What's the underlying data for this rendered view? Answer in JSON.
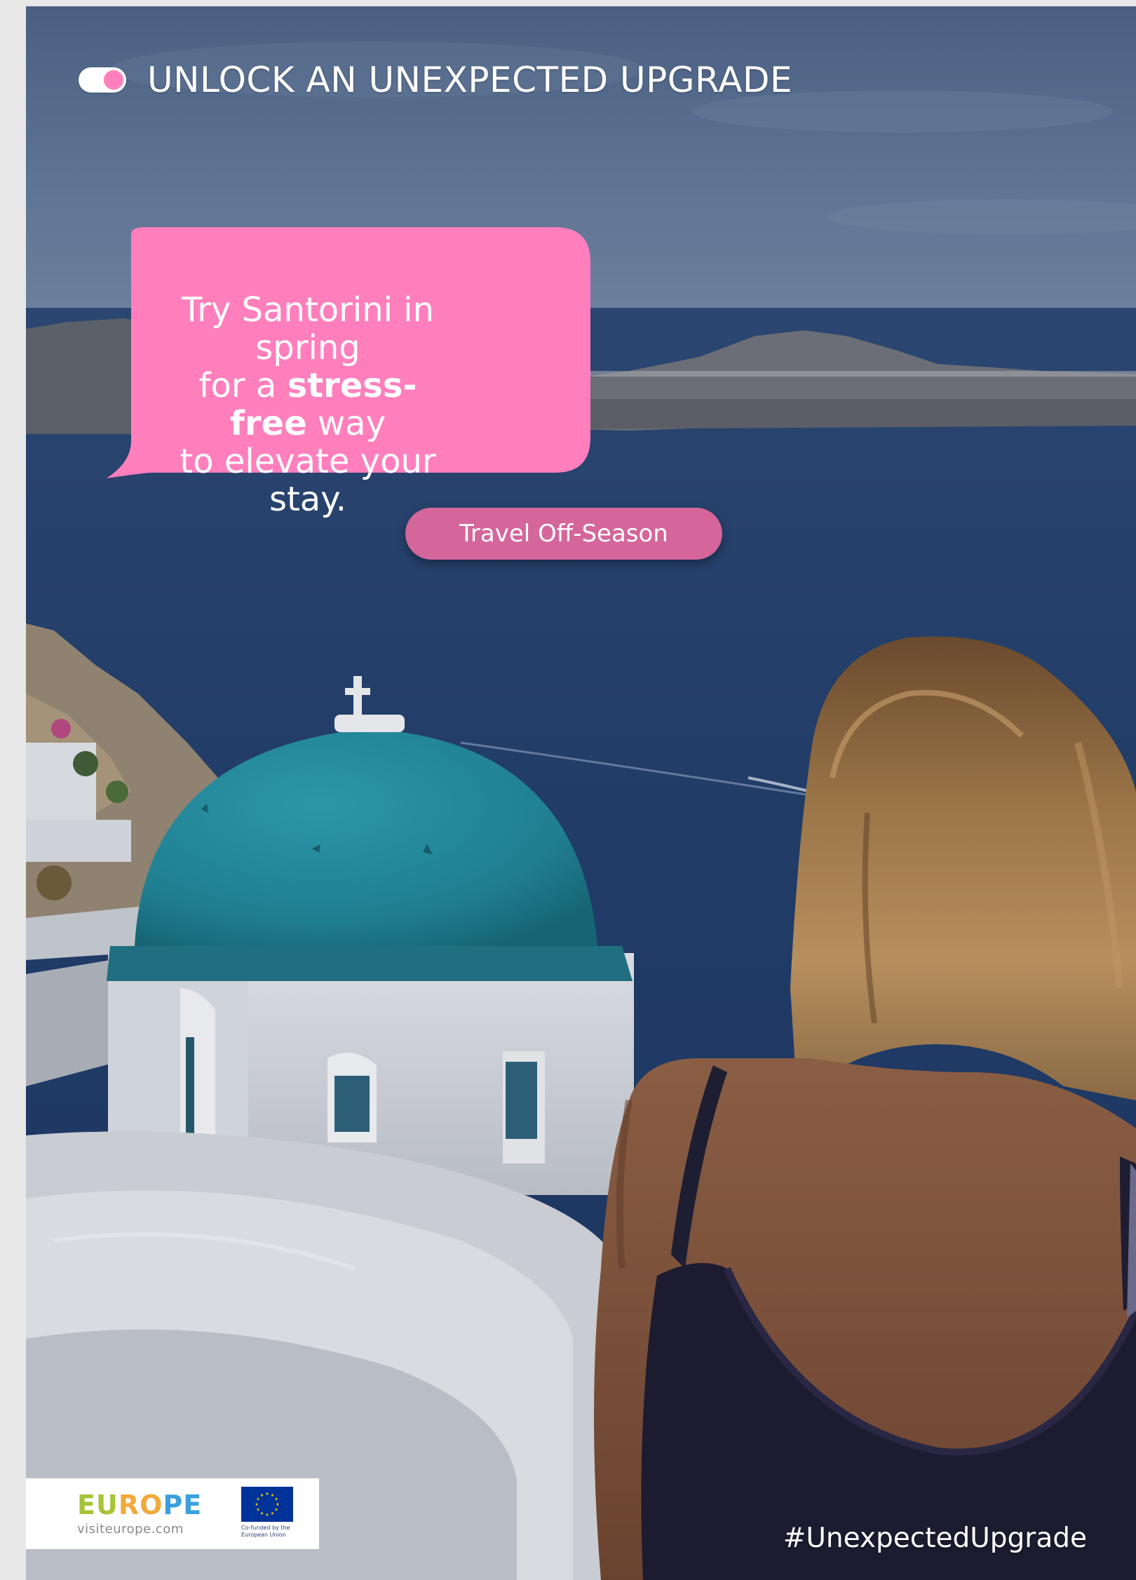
{
  "header": {
    "headline": "UNLOCK AN UNEXPECTED UPGRADE",
    "toggle_state": "on"
  },
  "bubble": {
    "line1": "Try Santorini in spring",
    "line2_pre": "for a ",
    "line2_bold": "stress-free",
    "line2_post": " way",
    "line3": "to elevate your stay."
  },
  "cta": {
    "label": "Travel Off-Season"
  },
  "logo": {
    "letters": [
      "E",
      "U",
      "R",
      "O",
      "P",
      "E"
    ],
    "letter_colors": [
      "#a5c437",
      "#a5c437",
      "#f2a93b",
      "#f2a93b",
      "#3aa0dd",
      "#3aa0dd"
    ],
    "url": "visiteurope.com",
    "eu_caption_line1": "Co-funded by the",
    "eu_caption_line2": "European Union"
  },
  "hashtag": "#UnexpectedUpgrade",
  "colors": {
    "accent_pink": "#ff7fbd",
    "button_pink": "#d4669b",
    "dome_blue": "#1f7f91",
    "sea": "#1f3964",
    "eu_blue": "#003399",
    "eu_star": "#ffcc00"
  },
  "icons": {
    "toggle": "toggle-switch-icon",
    "eu_flag": "eu-flag-icon"
  }
}
